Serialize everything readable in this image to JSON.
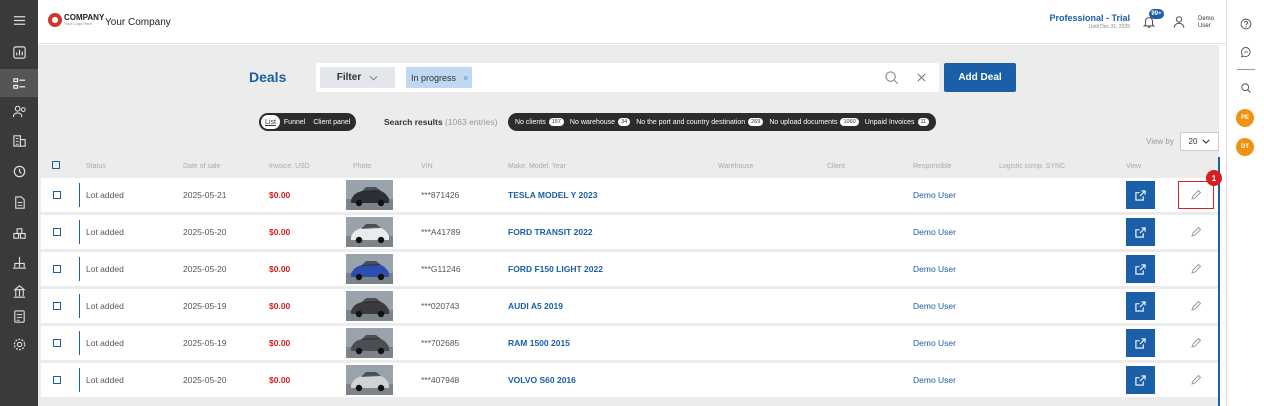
{
  "header": {
    "logo_name": "COMPANY",
    "logo_tag": "Your Logo Here",
    "company_name": "Your Company",
    "plan_title": "Professional - Trial",
    "plan_sub": "Until Dec 31, 2025",
    "notifications_badge": "99+",
    "user_name": "Demo User"
  },
  "sidebar": {
    "items": [
      "menu-icon",
      "dashboard-icon",
      "deals-icon",
      "users-icon",
      "buildings-icon",
      "history-icon",
      "document-icon",
      "warehouse-icon",
      "tree-icon",
      "network-icon",
      "report-icon",
      "gear-icon"
    ]
  },
  "rail": {
    "items": [
      "help-icon",
      "chat-icon",
      "search-icon"
    ],
    "avatars": [
      "PE",
      "DT"
    ]
  },
  "toolbar": {
    "title": "Deals",
    "filter_label": "Filter",
    "chip_label": "In progress",
    "chip_remove": "×",
    "add_deal_label": "Add Deal"
  },
  "views": {
    "items": [
      "List",
      "Funnel",
      "Client panel"
    ],
    "active": "List"
  },
  "search_results": {
    "label": "Search results",
    "count": "(1063 entries)"
  },
  "quick_filters": [
    {
      "label": "No clients",
      "count": "157"
    },
    {
      "label": "No warehouse",
      "count": "34"
    },
    {
      "label": "No the port and country destination",
      "count": "269"
    },
    {
      "label": "No upload documents",
      "count": "1060"
    },
    {
      "label": "Unpaid Invoices",
      "count": "11"
    }
  ],
  "view_by": {
    "label": "View by",
    "value": "20"
  },
  "table": {
    "columns": [
      "Status",
      "Date of sale",
      "Invoice, USD",
      "Photo",
      "VIN",
      "Make, Model, Year",
      "Warehouse",
      "Client",
      "Responsible",
      "Logistic comp. SYNC",
      "View"
    ],
    "rows": [
      {
        "status": "Lot added",
        "date": "2025-05-21",
        "invoice": "$0.00",
        "vin": "***871426",
        "make": "TESLA MODEL Y 2023",
        "responsible": "Demo User",
        "car_color": "#2b2f36"
      },
      {
        "status": "Lot added",
        "date": "2025-05-20",
        "invoice": "$0.00",
        "vin": "***A41789",
        "make": "FORD TRANSIT 2022",
        "responsible": "Demo User",
        "car_color": "#e9ecef"
      },
      {
        "status": "Lot added",
        "date": "2025-05-20",
        "invoice": "$0.00",
        "vin": "***G11246",
        "make": "FORD F150 LIGHT 2022",
        "responsible": "Demo User",
        "car_color": "#2a4fb0"
      },
      {
        "status": "Lot added",
        "date": "2025-05-19",
        "invoice": "$0.00",
        "vin": "***020743",
        "make": "AUDI A5 2019",
        "responsible": "Demo User",
        "car_color": "#3b3b3f"
      },
      {
        "status": "Lot added",
        "date": "2025-05-19",
        "invoice": "$0.00",
        "vin": "***702685",
        "make": "RAM 1500 2015",
        "responsible": "Demo User",
        "car_color": "#4a4d52"
      },
      {
        "status": "Lot added",
        "date": "2025-05-20",
        "invoice": "$0.00",
        "vin": "***407948",
        "make": "VOLVO S60 2016",
        "responsible": "Demo User",
        "car_color": "#cfd3d8"
      }
    ]
  },
  "annotation": {
    "marker": "1"
  },
  "colors": {
    "brand": "#1a5fa8",
    "price": "#d41d1d",
    "sidebar": "#3a3a3a",
    "accent_avatar": "#f29111"
  }
}
